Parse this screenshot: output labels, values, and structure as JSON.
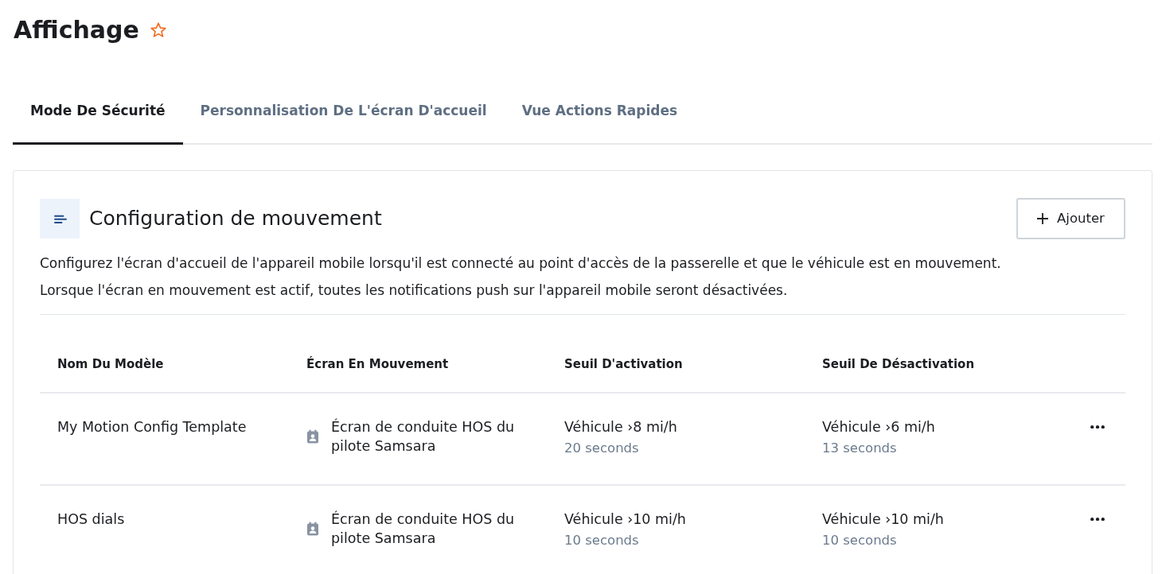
{
  "page": {
    "title": "Affichage",
    "starred": false
  },
  "tabs": [
    {
      "label": "Mode De Sécurité",
      "selected": true
    },
    {
      "label": "Personnalisation De L'écran D'accueil",
      "selected": false
    },
    {
      "label": "Vue Actions Rapides",
      "selected": false
    }
  ],
  "card": {
    "title": "Configuration de mouvement",
    "add_button": "Ajouter",
    "description": [
      "Configurez l'écran d'accueil de l'appareil mobile lorsqu'il est connecté au point d'accès de la passerelle et que le véhicule est en mouvement.",
      "Lorsque l'écran en mouvement est actif, toutes les notifications push sur l'appareil mobile seront désactivées."
    ]
  },
  "table": {
    "columns": [
      "Nom Du Modèle",
      "Écran En Mouvement",
      "Seuil D'activation",
      "Seuil De Désactivation"
    ],
    "rows": [
      {
        "name": "My Motion Config Template",
        "screen": "Écran de conduite HOS du pilote Samsara",
        "activation": {
          "value": "Véhicule ›8 mi/h",
          "duration": "20 seconds"
        },
        "deactivation": {
          "value": "Véhicule ›6 mi/h",
          "duration": "13 seconds"
        }
      },
      {
        "name": "HOS dials",
        "screen": "Écran de conduite HOS du pilote Samsara",
        "activation": {
          "value": "Véhicule ›10 mi/h",
          "duration": "10 seconds"
        },
        "deactivation": {
          "value": "Véhicule ›10 mi/h",
          "duration": "10 seconds"
        }
      }
    ]
  }
}
